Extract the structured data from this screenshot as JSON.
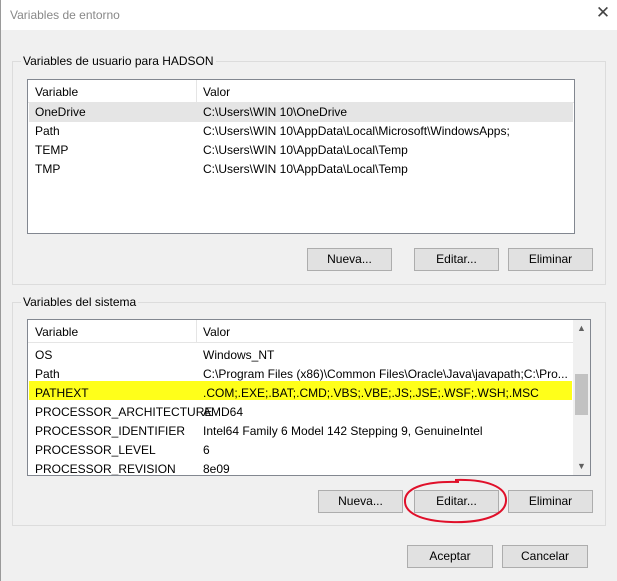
{
  "window": {
    "title": "Variables de entorno",
    "close_glyph": "✕"
  },
  "user_group": {
    "label": "Variables de usuario para HADSON",
    "columns": [
      "Variable",
      "Valor"
    ],
    "rows": [
      {
        "name": "OneDrive",
        "value": "C:\\Users\\WIN 10\\OneDrive"
      },
      {
        "name": "Path",
        "value": "C:\\Users\\WIN 10\\AppData\\Local\\Microsoft\\WindowsApps;"
      },
      {
        "name": "TEMP",
        "value": "C:\\Users\\WIN 10\\AppData\\Local\\Temp"
      },
      {
        "name": "TMP",
        "value": "C:\\Users\\WIN 10\\AppData\\Local\\Temp"
      }
    ],
    "buttons": {
      "new": "Nueva...",
      "edit": "Editar...",
      "delete": "Eliminar"
    }
  },
  "system_group": {
    "label": "Variables del sistema",
    "columns": [
      "Variable",
      "Valor"
    ],
    "rows": [
      {
        "name": "OS",
        "value": "Windows_NT"
      },
      {
        "name": "Path",
        "value": "C:\\Program Files (x86)\\Common Files\\Oracle\\Java\\javapath;C:\\Pro..."
      },
      {
        "name": "PATHEXT",
        "value": ".COM;.EXE;.BAT;.CMD;.VBS;.VBE;.JS;.JSE;.WSF;.WSH;.MSC"
      },
      {
        "name": "PROCESSOR_ARCHITECTURE",
        "value": "AMD64"
      },
      {
        "name": "PROCESSOR_IDENTIFIER",
        "value": "Intel64 Family 6 Model 142 Stepping 9, GenuineIntel"
      },
      {
        "name": "PROCESSOR_LEVEL",
        "value": "6"
      },
      {
        "name": "PROCESSOR_REVISION",
        "value": "8e09"
      }
    ],
    "buttons": {
      "new": "Nueva...",
      "edit": "Editar...",
      "delete": "Eliminar"
    }
  },
  "footer": {
    "ok": "Aceptar",
    "cancel": "Cancelar"
  },
  "annotations": {
    "highlight_color": "#ffff1a",
    "circle_color": "#e0102a"
  }
}
